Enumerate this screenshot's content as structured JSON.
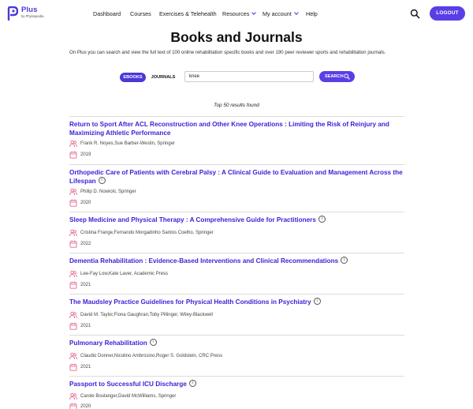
{
  "header": {
    "logo_title": "Plus",
    "logo_sub": "by Physiopedia",
    "nav": [
      {
        "label": "Dashboard",
        "dropdown": false
      },
      {
        "label": "Courses",
        "dropdown": false
      },
      {
        "label": "Exercises & Telehealth",
        "dropdown": false
      },
      {
        "label": "Resources",
        "dropdown": true
      },
      {
        "label": "My account",
        "dropdown": true
      },
      {
        "label": "Help",
        "dropdown": false
      }
    ],
    "search_icon": "search-icon",
    "logout_label": "LOGOUT"
  },
  "page": {
    "title": "Books and Journals",
    "intro": "On Plus you can search and view the full text of 100 online rehabilitation specific books and over 190 peer reviewer sports and rehabilitation journals."
  },
  "search": {
    "tab_ebooks": "EBOOKS",
    "tab_journals": "JOURNALS",
    "query": "knee",
    "button_label": "SEARCH"
  },
  "results_count": "Top 50 results found",
  "results": [
    {
      "title": "Return to Sport After ACL Reconstruction and Other Knee Operations : Limiting the Risk of Reinjury and Maximizing Athletic Performance",
      "authors": "Frank R. Noyes,Sue Barber-Westin, Springer",
      "year": "2019"
    },
    {
      "title": "Orthopedic Care of Patients with Cerebral Palsy : A Clinical Guide to Evaluation and Management Across the Lifespan",
      "authors": "Philip D. Nowicki, Springer",
      "year": "2020"
    },
    {
      "title": "Sleep Medicine and Physical Therapy : A Comprehensive Guide for Practitioners",
      "authors": "Cristina Frange,Fernando Morgadinho Santos Coelho, Springer",
      "year": "2022"
    },
    {
      "title": "Dementia Rehabilitation : Evidence-Based Interventions and Clinical Recommendations",
      "authors": "Lee-Fay Low,Kate Laver, Academic Press",
      "year": "2021"
    },
    {
      "title": "The Maudsley Practice Guidelines for Physical Health Conditions in Psychiatry",
      "authors": "David M. Taylor,Fiona Gaughran,Toby Pillinger, Wiley-Blackwell",
      "year": "2021"
    },
    {
      "title": "Pulmonary Rehabilitation",
      "authors": "Claudio Donner,Nicolino Ambrosino,Roger S. Goldstein, CRC Press",
      "year": "2021"
    },
    {
      "title": "Passport to Successful ICU Discharge",
      "authors": "Carole Boulanger,David McWilliams, Springer",
      "year": "2020"
    }
  ],
  "colors": {
    "accent": "#5b3ee6",
    "title_link": "#3d1fd6",
    "icon_pink": "#e46a8c"
  }
}
